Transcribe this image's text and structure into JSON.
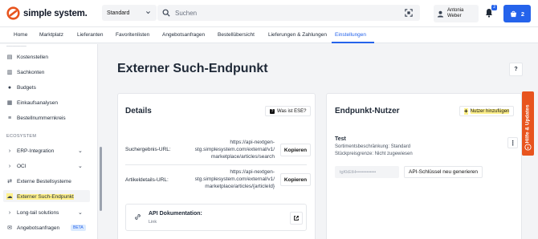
{
  "brand": {
    "name": "simple system."
  },
  "header": {
    "assortment_select": "Standard",
    "search_placeholder": "Suchen",
    "user_first": "Antonia",
    "user_last": "Weber",
    "notification_count": "2",
    "cart_count": "2"
  },
  "nav": {
    "tabs": [
      {
        "label": "Home"
      },
      {
        "label": "Marktplatz"
      },
      {
        "label": "Lieferanten"
      },
      {
        "label": "Favoritenlisten"
      },
      {
        "label": "Angebotsanfragen"
      },
      {
        "label": "Bestellübersicht"
      },
      {
        "label": "Lieferungen & Zahlungen"
      },
      {
        "label": "Einstellungen"
      }
    ]
  },
  "sidebar": {
    "items": [
      {
        "label": "Kostenstellen"
      },
      {
        "label": "Sachkonten"
      },
      {
        "label": "Budgets"
      },
      {
        "label": "Einkaufsanalysen"
      },
      {
        "label": "Bestellnummernkreis"
      }
    ],
    "section": "ECOSYSTEM",
    "eco_items": [
      {
        "label": "ERP-Integration"
      },
      {
        "label": "OCI"
      },
      {
        "label": "Externe Bestellsysteme"
      },
      {
        "label": "Externer Such-Endpunkt"
      },
      {
        "label": "Long-tail solutions"
      },
      {
        "label": "Angebotsanfragen"
      }
    ],
    "beta": "BETA"
  },
  "page": {
    "title": "Externer Such-Endpunkt",
    "help": "?"
  },
  "details": {
    "title": "Details",
    "what_is_ese": "Was ist ESE?",
    "rows": [
      {
        "label": "Suchergebnis-URL:",
        "url_lines": [
          "https://api-nextgen-",
          "stg.simplesystem.com/external/v1/",
          "marketplace/articles/search"
        ],
        "copy": "Kopieren"
      },
      {
        "label": "Artikeldetails-URL:",
        "url_lines": [
          "https://api-nextgen-",
          "stg.simplesystem.com/external/v1/",
          "marketplace/articles/{articleId}"
        ],
        "copy": "Kopieren"
      }
    ],
    "api_doc": {
      "title": "API Dokumentation:",
      "sub": "Link"
    }
  },
  "users": {
    "title": "Endpunkt-Nutzer",
    "add": "Nutzer hinzufügen",
    "user_name": "Test",
    "restriction": "Sortimentsbeschränkung: Standard",
    "price_limit": "Stückpreisgrenze: Nicht zugewiesen",
    "masked_key": "tgKkEtH•••••••••••••",
    "regen": "API-Schlüssel neu generieren"
  },
  "side_tab": {
    "label": "Hilfe & Updates"
  },
  "colors": {
    "primary": "#2563eb",
    "accent": "#e8541e",
    "highlight": "#fef08a"
  }
}
